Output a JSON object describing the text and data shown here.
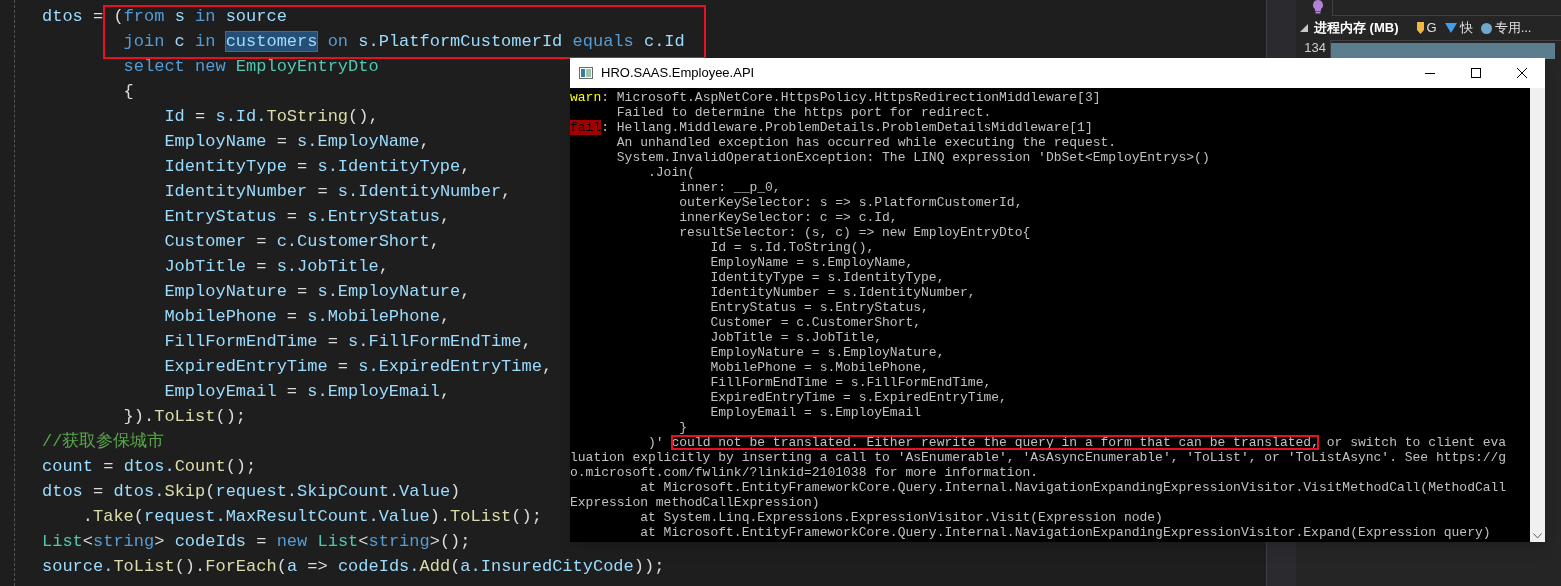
{
  "editor": {
    "lines": [
      {
        "framed": true,
        "tokens": [
          {
            "text": "dtos",
            "kind": "variable"
          },
          {
            "text": " = (",
            "kind": "plain"
          },
          {
            "text": "from",
            "kind": "keyword"
          },
          {
            "text": " s",
            "kind": "variable"
          },
          {
            "text": " in",
            "kind": "keyword"
          },
          {
            "text": " source",
            "kind": "variable"
          }
        ]
      },
      {
        "framed": true,
        "tokens": [
          {
            "text": "        join",
            "kind": "keyword"
          },
          {
            "text": " c",
            "kind": "variable"
          },
          {
            "text": " in ",
            "kind": "keyword"
          },
          {
            "text": "customers",
            "kind": "variable",
            "selected": true
          },
          {
            "text": " on",
            "kind": "keyword"
          },
          {
            "text": " s.PlatformCustomerId",
            "kind": "variable"
          },
          {
            "text": " equals",
            "kind": "keyword"
          },
          {
            "text": " c.Id",
            "kind": "variable"
          }
        ]
      },
      {
        "framed": false,
        "tokens": [
          {
            "text": "        select",
            "kind": "keyword"
          },
          {
            "text": " new",
            "kind": "keyword"
          },
          {
            "text": " EmployEntryDto",
            "kind": "type"
          }
        ]
      },
      {
        "framed": false,
        "tokens": [
          {
            "text": "        {",
            "kind": "plain"
          }
        ]
      },
      {
        "framed": false,
        "tokens": [
          {
            "text": "            Id",
            "kind": "variable"
          },
          {
            "text": " = ",
            "kind": "plain"
          },
          {
            "text": "s.Id.",
            "kind": "variable"
          },
          {
            "text": "ToString",
            "kind": "method"
          },
          {
            "text": "(),",
            "kind": "plain"
          }
        ]
      },
      {
        "framed": false,
        "tokens": [
          {
            "text": "            EmployName",
            "kind": "variable"
          },
          {
            "text": " = ",
            "kind": "plain"
          },
          {
            "text": "s.EmployName",
            "kind": "variable"
          },
          {
            "text": ",",
            "kind": "plain"
          }
        ]
      },
      {
        "framed": false,
        "tokens": [
          {
            "text": "            IdentityType",
            "kind": "variable"
          },
          {
            "text": " = ",
            "kind": "plain"
          },
          {
            "text": "s.IdentityType",
            "kind": "variable"
          },
          {
            "text": ",",
            "kind": "plain"
          }
        ]
      },
      {
        "framed": false,
        "tokens": [
          {
            "text": "            IdentityNumber",
            "kind": "variable"
          },
          {
            "text": " = ",
            "kind": "plain"
          },
          {
            "text": "s.IdentityNumber",
            "kind": "variable"
          },
          {
            "text": ",",
            "kind": "plain"
          }
        ]
      },
      {
        "framed": false,
        "tokens": [
          {
            "text": "            EntryStatus",
            "kind": "variable"
          },
          {
            "text": " = ",
            "kind": "plain"
          },
          {
            "text": "s.EntryStatus",
            "kind": "variable"
          },
          {
            "text": ",",
            "kind": "plain"
          }
        ]
      },
      {
        "framed": false,
        "tokens": [
          {
            "text": "            Customer",
            "kind": "variable"
          },
          {
            "text": " = ",
            "kind": "plain"
          },
          {
            "text": "c.CustomerShort",
            "kind": "variable"
          },
          {
            "text": ",",
            "kind": "plain"
          }
        ]
      },
      {
        "framed": false,
        "tokens": [
          {
            "text": "            JobTitle",
            "kind": "variable"
          },
          {
            "text": " = ",
            "kind": "plain"
          },
          {
            "text": "s.JobTitle",
            "kind": "variable"
          },
          {
            "text": ",",
            "kind": "plain"
          }
        ]
      },
      {
        "framed": false,
        "tokens": [
          {
            "text": "            EmployNature",
            "kind": "variable"
          },
          {
            "text": " = ",
            "kind": "plain"
          },
          {
            "text": "s.EmployNature",
            "kind": "variable"
          },
          {
            "text": ",",
            "kind": "plain"
          }
        ]
      },
      {
        "framed": false,
        "tokens": [
          {
            "text": "            MobilePhone",
            "kind": "variable"
          },
          {
            "text": " = ",
            "kind": "plain"
          },
          {
            "text": "s.MobilePhone",
            "kind": "variable"
          },
          {
            "text": ",",
            "kind": "plain"
          }
        ]
      },
      {
        "framed": false,
        "tokens": [
          {
            "text": "            FillFormEndTime",
            "kind": "variable"
          },
          {
            "text": " = ",
            "kind": "plain"
          },
          {
            "text": "s.FillFormEndTime",
            "kind": "variable"
          },
          {
            "text": ",",
            "kind": "plain"
          }
        ]
      },
      {
        "framed": false,
        "tokens": [
          {
            "text": "            ExpiredEntryTime",
            "kind": "variable"
          },
          {
            "text": " = ",
            "kind": "plain"
          },
          {
            "text": "s.ExpiredEntryTime",
            "kind": "variable"
          },
          {
            "text": ",",
            "kind": "plain"
          }
        ]
      },
      {
        "framed": false,
        "tokens": [
          {
            "text": "            EmployEmail",
            "kind": "variable"
          },
          {
            "text": " = ",
            "kind": "plain"
          },
          {
            "text": "s.EmployEmail",
            "kind": "variable"
          },
          {
            "text": ",",
            "kind": "plain"
          }
        ]
      },
      {
        "framed": false,
        "tokens": [
          {
            "text": "        }).",
            "kind": "plain"
          },
          {
            "text": "ToList",
            "kind": "method"
          },
          {
            "text": "();",
            "kind": "plain"
          }
        ]
      },
      {
        "framed": false,
        "tokens": [
          {
            "text": "//获取参保城市",
            "kind": "comment"
          }
        ]
      },
      {
        "framed": false,
        "tokens": [
          {
            "text": "count",
            "kind": "variable"
          },
          {
            "text": " = ",
            "kind": "plain"
          },
          {
            "text": "dtos.",
            "kind": "variable"
          },
          {
            "text": "Count",
            "kind": "method"
          },
          {
            "text": "();",
            "kind": "plain"
          }
        ]
      },
      {
        "framed": false,
        "tokens": [
          {
            "text": "dtos",
            "kind": "variable"
          },
          {
            "text": " = ",
            "kind": "plain"
          },
          {
            "text": "dtos.",
            "kind": "variable"
          },
          {
            "text": "Skip",
            "kind": "method"
          },
          {
            "text": "(",
            "kind": "plain"
          },
          {
            "text": "request.SkipCount.Value",
            "kind": "variable"
          },
          {
            "text": ")",
            "kind": "plain"
          }
        ]
      },
      {
        "framed": false,
        "tokens": [
          {
            "text": "    .",
            "kind": "plain"
          },
          {
            "text": "Take",
            "kind": "method"
          },
          {
            "text": "(",
            "kind": "plain"
          },
          {
            "text": "request.MaxResultCount.Value",
            "kind": "variable"
          },
          {
            "text": ").",
            "kind": "plain"
          },
          {
            "text": "ToList",
            "kind": "method"
          },
          {
            "text": "();",
            "kind": "plain"
          }
        ]
      },
      {
        "framed": false,
        "tokens": [
          {
            "text": "List",
            "kind": "type"
          },
          {
            "text": "<",
            "kind": "plain"
          },
          {
            "text": "string",
            "kind": "keyword"
          },
          {
            "text": "> ",
            "kind": "plain"
          },
          {
            "text": "codeIds",
            "kind": "variable"
          },
          {
            "text": " = ",
            "kind": "plain"
          },
          {
            "text": "new",
            "kind": "keyword"
          },
          {
            "text": " List",
            "kind": "type"
          },
          {
            "text": "<",
            "kind": "plain"
          },
          {
            "text": "string",
            "kind": "keyword"
          },
          {
            "text": ">();",
            "kind": "plain"
          }
        ]
      },
      {
        "framed": false,
        "tokens": [
          {
            "text": "source.",
            "kind": "variable"
          },
          {
            "text": "ToList",
            "kind": "method"
          },
          {
            "text": "().",
            "kind": "plain"
          },
          {
            "text": "ForEach",
            "kind": "method"
          },
          {
            "text": "(",
            "kind": "plain"
          },
          {
            "text": "a",
            "kind": "variable"
          },
          {
            "text": " => ",
            "kind": "plain"
          },
          {
            "text": "codeIds.",
            "kind": "variable"
          },
          {
            "text": "Add",
            "kind": "method"
          },
          {
            "text": "(",
            "kind": "plain"
          },
          {
            "text": "a.InsuredCityCode",
            "kind": "variable"
          },
          {
            "text": "));",
            "kind": "plain"
          }
        ]
      }
    ]
  },
  "console": {
    "title": "HRO.SAAS.Employee.API",
    "lines": [
      {
        "segments": [
          {
            "text": "warn",
            "kind": "warn"
          },
          {
            "text": ": Microsoft.AspNetCore.HttpsPolicy.HttpsRedirectionMiddleware[3]",
            "kind": "plain"
          }
        ]
      },
      {
        "segments": [
          {
            "text": "      Failed to determine the https port for redirect.",
            "kind": "plain"
          }
        ]
      },
      {
        "segments": [
          {
            "text": "fail",
            "kind": "fail"
          },
          {
            "text": ": Hellang.Middleware.ProblemDetails.ProblemDetailsMiddleware[1]",
            "kind": "plain"
          }
        ]
      },
      {
        "segments": [
          {
            "text": "      An unhandled exception has occurred while executing the request.",
            "kind": "plain"
          }
        ]
      },
      {
        "segments": [
          {
            "text": "      System.InvalidOperationException: The LINQ expression 'DbSet<EmployEntrys>()",
            "kind": "plain"
          }
        ]
      },
      {
        "segments": [
          {
            "text": "          .Join(",
            "kind": "plain"
          }
        ]
      },
      {
        "segments": [
          {
            "text": "              inner: __p_0,",
            "kind": "plain"
          }
        ]
      },
      {
        "segments": [
          {
            "text": "              outerKeySelector: s => s.PlatformCustomerId,",
            "kind": "plain"
          }
        ]
      },
      {
        "segments": [
          {
            "text": "              innerKeySelector: c => c.Id,",
            "kind": "plain"
          }
        ]
      },
      {
        "segments": [
          {
            "text": "              resultSelector: (s, c) => new EmployEntryDto{",
            "kind": "plain"
          }
        ]
      },
      {
        "segments": [
          {
            "text": "                  Id = s.Id.ToString(),",
            "kind": "plain"
          }
        ]
      },
      {
        "segments": [
          {
            "text": "                  EmployName = s.EmployName,",
            "kind": "plain"
          }
        ]
      },
      {
        "segments": [
          {
            "text": "                  IdentityType = s.IdentityType,",
            "kind": "plain"
          }
        ]
      },
      {
        "segments": [
          {
            "text": "                  IdentityNumber = s.IdentityNumber,",
            "kind": "plain"
          }
        ]
      },
      {
        "segments": [
          {
            "text": "                  EntryStatus = s.EntryStatus,",
            "kind": "plain"
          }
        ]
      },
      {
        "segments": [
          {
            "text": "                  Customer = c.CustomerShort,",
            "kind": "plain"
          }
        ]
      },
      {
        "segments": [
          {
            "text": "                  JobTitle = s.JobTitle,",
            "kind": "plain"
          }
        ]
      },
      {
        "segments": [
          {
            "text": "                  EmployNature = s.EmployNature,",
            "kind": "plain"
          }
        ]
      },
      {
        "segments": [
          {
            "text": "                  MobilePhone = s.MobilePhone,",
            "kind": "plain"
          }
        ]
      },
      {
        "segments": [
          {
            "text": "                  FillFormEndTime = s.FillFormEndTime,",
            "kind": "plain"
          }
        ]
      },
      {
        "segments": [
          {
            "text": "                  ExpiredEntryTime = s.ExpiredEntryTime,",
            "kind": "plain"
          }
        ]
      },
      {
        "segments": [
          {
            "text": "                  EmployEmail = s.EmployEmail",
            "kind": "plain"
          }
        ]
      },
      {
        "segments": [
          {
            "text": "              }",
            "kind": "plain"
          }
        ]
      },
      {
        "segments": [
          {
            "text": "          )' ",
            "kind": "plain"
          },
          {
            "text": "could not be translated. Either rewrite the query in a form that can be translated,",
            "kind": "boxed"
          },
          {
            "text": " or switch to client eva",
            "kind": "plain"
          }
        ]
      },
      {
        "segments": [
          {
            "text": "luation explicitly by inserting a call to 'AsEnumerable', 'AsAsyncEnumerable', 'ToList', or 'ToListAsync'. See https://g",
            "kind": "plain"
          }
        ]
      },
      {
        "segments": [
          {
            "text": "o.microsoft.com/fwlink/?linkid=2101038 for more information.",
            "kind": "plain"
          }
        ]
      },
      {
        "segments": [
          {
            "text": "         at Microsoft.EntityFrameworkCore.Query.Internal.NavigationExpandingExpressionVisitor.VisitMethodCall(MethodCall",
            "kind": "plain"
          }
        ]
      },
      {
        "segments": [
          {
            "text": "Expression methodCallExpression)",
            "kind": "plain"
          }
        ]
      },
      {
        "segments": [
          {
            "text": "         at System.Linq.Expressions.ExpressionVisitor.Visit(Expression node)",
            "kind": "plain"
          }
        ]
      },
      {
        "segments": [
          {
            "text": "         at Microsoft.EntityFrameworkCore.Query.Internal.NavigationExpandingExpressionVisitor.Expand(Expression query)",
            "kind": "plain"
          }
        ]
      }
    ]
  },
  "diagnostics": {
    "section": "进程内存 (MB)",
    "legend": [
      {
        "label": "G",
        "kind": "gc"
      },
      {
        "label": "快",
        "kind": "snapshot"
      },
      {
        "label": "专用...",
        "kind": "private"
      }
    ],
    "axis_max": "134"
  }
}
